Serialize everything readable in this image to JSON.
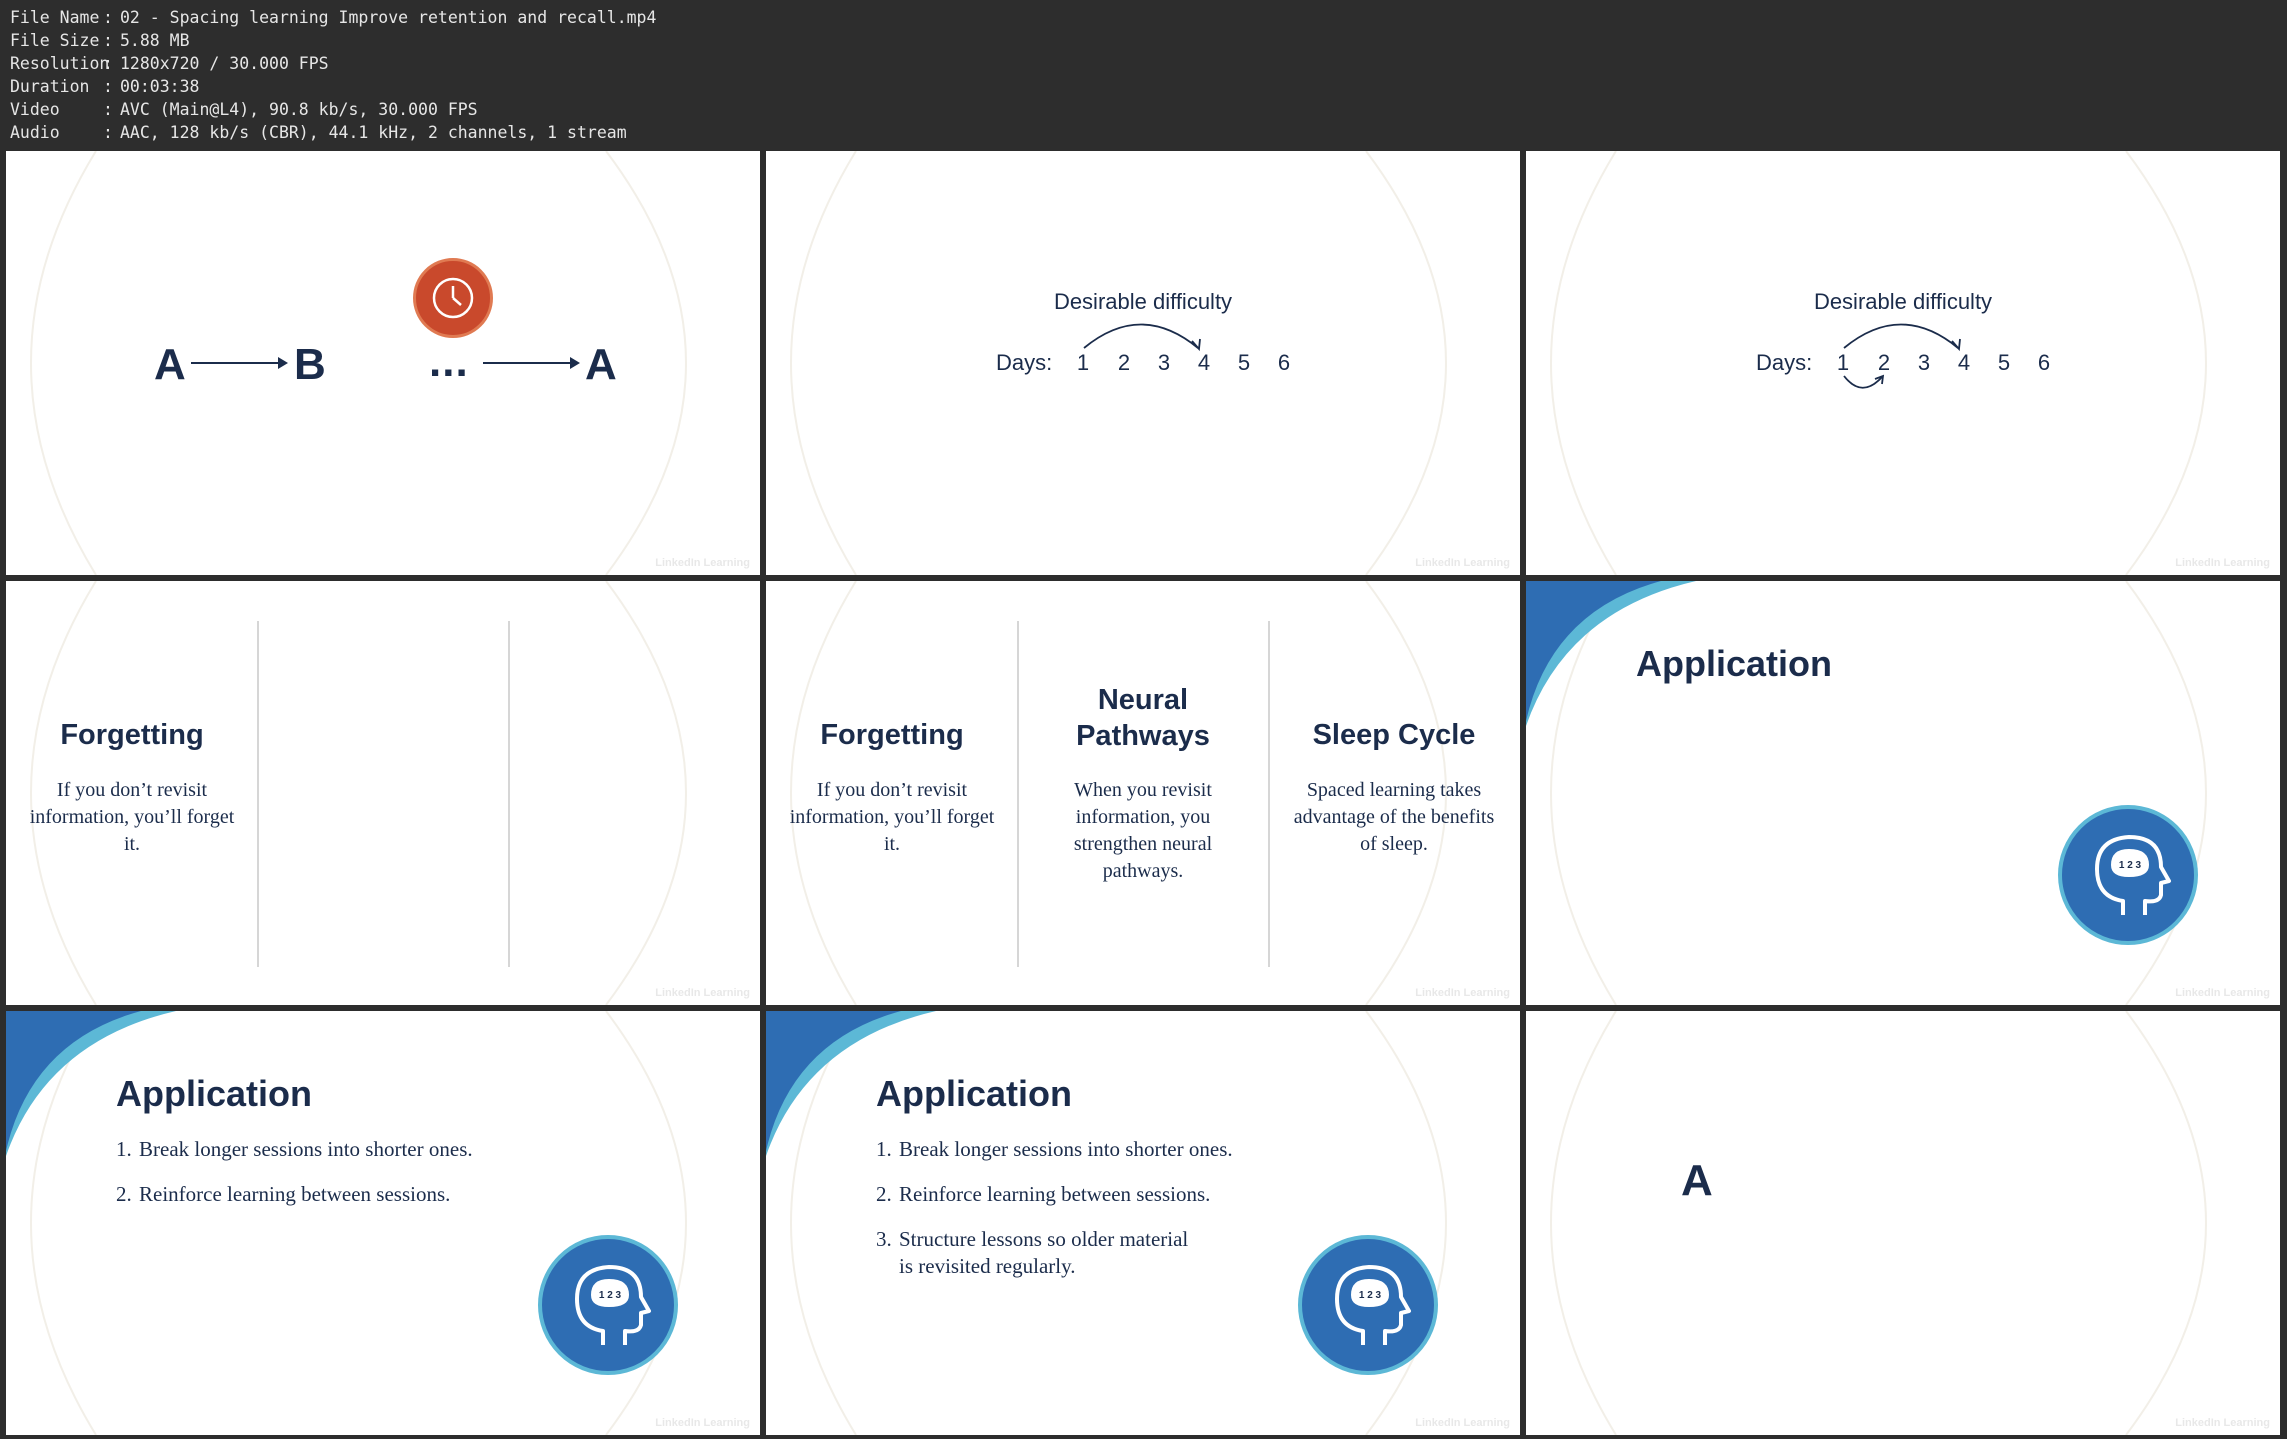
{
  "info": [
    {
      "key": "File Name",
      "value": "02 - Spacing learning Improve retention and recall.mp4"
    },
    {
      "key": "File Size",
      "value": "5.88 MB"
    },
    {
      "key": "Resolution",
      "value": "1280x720 / 30.000 FPS"
    },
    {
      "key": "Duration",
      "value": "00:03:38"
    },
    {
      "key": "Video",
      "value": "AVC (Main@L4), 90.8 kb/s, 30.000 FPS"
    },
    {
      "key": "Audio",
      "value": "AAC, 128 kb/s (CBR), 44.1 kHz, 2 channels, 1 stream"
    }
  ],
  "info_separator": ":",
  "watermark": "LinkedIn Learning",
  "frame1": {
    "left_a": "A",
    "b": "B",
    "dots": "...",
    "right_a": "A",
    "icon": "clock-icon",
    "icon_color": "#c9492c"
  },
  "desirable": {
    "title": "Desirable difficulty",
    "days_label": "Days:",
    "days": [
      "1",
      "2",
      "3",
      "4",
      "5",
      "6"
    ]
  },
  "columns": {
    "forgetting": {
      "title": "Forgetting",
      "text": "If you don’t revisit information, you’ll forget it."
    },
    "neural": {
      "title_line1": "Neural",
      "title_line2": "Pathways",
      "text": "When you revisit information, you strengthen neural pathways."
    },
    "sleep": {
      "title": "Sleep Cycle",
      "text": "Spaced learning takes advantage of the benefits of sleep."
    }
  },
  "application": {
    "title": "Application",
    "items": [
      {
        "num": "1.",
        "text": "Break longer sessions into shorter ones."
      },
      {
        "num": "2.",
        "text": "Reinforce learning between sessions."
      },
      {
        "num": "3.",
        "line1": "Structure lessons so older material",
        "line2": "is revisited regularly."
      }
    ],
    "badge_icon": "brain-head-icon",
    "badge_numbers": "1 2 3",
    "badge_color": "#2e6db3",
    "accent_dark": "#2e6db3",
    "accent_light": "#5cb8d6"
  },
  "frame9": {
    "letter": "A"
  }
}
